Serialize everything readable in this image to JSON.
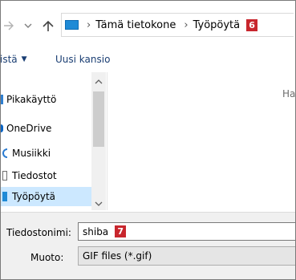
{
  "address": {
    "path": [
      "Tämä tietokone",
      "Työpöytä"
    ],
    "step_badge": "6",
    "pc_icon": "computer-icon"
  },
  "toolbar": {
    "organize_label": "istä",
    "new_folder_label": "Uusi kansio"
  },
  "sidebar": {
    "items": [
      {
        "label": "Pikakäyttö",
        "icon": "quick-access-icon",
        "selected": false
      },
      {
        "label": "OneDrive",
        "icon": "onedrive-icon",
        "selected": false
      },
      {
        "label": "Musiikki",
        "icon": "music-icon",
        "selected": false
      },
      {
        "label": "Tiedostot",
        "icon": "documents-icon",
        "selected": false
      },
      {
        "label": "Työpöytä",
        "icon": "desktop-icon",
        "selected": true
      }
    ]
  },
  "content": {
    "hint": "Ha"
  },
  "save": {
    "filename_label": "Tiedostonimi:",
    "filename_value": "shiba",
    "filename_badge": "7",
    "filetype_label": "Muoto:",
    "filetype_value": "GIF files (*.gif)"
  },
  "colors": {
    "badge": "#c8262d",
    "selected_bg": "#cce8ff",
    "link_text": "#1a3e73"
  }
}
